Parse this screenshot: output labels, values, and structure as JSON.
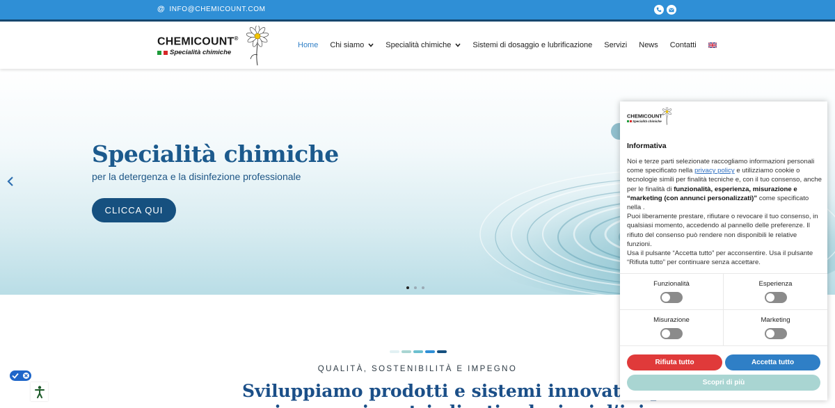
{
  "topbar": {
    "email": "INFO@CHEMICOUNT.COM",
    "icons": [
      "phone-icon",
      "mail-icon"
    ]
  },
  "logo": {
    "name": "CHEMICOUNT",
    "registered": "®",
    "tagline": "Specialità chimiche"
  },
  "nav": {
    "items": [
      {
        "label": "Home",
        "active": true
      },
      {
        "label": "Chi siamo",
        "dropdown": true
      },
      {
        "label": "Specialità chimiche",
        "dropdown": true
      },
      {
        "label": "Sistemi di dosaggio e lubrificazione"
      },
      {
        "label": "Servizi"
      },
      {
        "label": "News"
      },
      {
        "label": "Contatti"
      }
    ],
    "language_icon": "uk-flag-icon"
  },
  "hero": {
    "title": "Specialità chimiche",
    "subtitle": "per la detergenza e la disinfezione professionale",
    "button_label": "CLICCA QUI",
    "slide_count": 3,
    "active_slide": 1
  },
  "content": {
    "section_label": "QUALITÀ, SOSTENIBILITÀ E IMPEGNO",
    "section_title": "Sviluppiamo prodotti e sistemi innovativi per",
    "section_title_line2": "assicurare ai nostri clienti soluzioni d’igiene"
  },
  "cookie": {
    "heading": "Informativa",
    "p1_a": "Noi e terze parti selezionate raccogliamo informazioni personali come specificato nella ",
    "privacy_link": "privacy policy",
    "p1_b": " e utilizziamo cookie o tecnologie simili per finalità tecniche e, con il tuo consenso, anche per le finalità di ",
    "p1_bold": "funzionalità, esperienza, misurazione e “marketing (con annunci personalizzati)”",
    "p1_c": " come specificato nella .",
    "p2": "Puoi liberamente prestare, rifiutare o revocare il tuo consenso, in qualsiasi momento, accedendo al pannello delle preferenze. Il rifiuto del consenso può rendere non disponibili le relative funzioni.",
    "p3": "Usa il pulsante “Accetta tutto” per acconsentire. Usa il pulsante “Rifiuta tutto” per continuare senza accettare.",
    "toggles": [
      {
        "label": "Funzionalità",
        "enabled": false
      },
      {
        "label": "Esperienza",
        "enabled": false
      },
      {
        "label": "Misurazione",
        "enabled": false
      },
      {
        "label": "Marketing",
        "enabled": false
      }
    ],
    "reject_label": "Rifiuta tutto",
    "accept_label": "Accetta tutto",
    "more_label": "Scopri di più"
  },
  "colors": {
    "topbar": "#2f8fd6",
    "brand_dark": "#16507f",
    "reject": "#e03a3a",
    "accept": "#2f7fc6",
    "more": "#a9d5d2"
  }
}
